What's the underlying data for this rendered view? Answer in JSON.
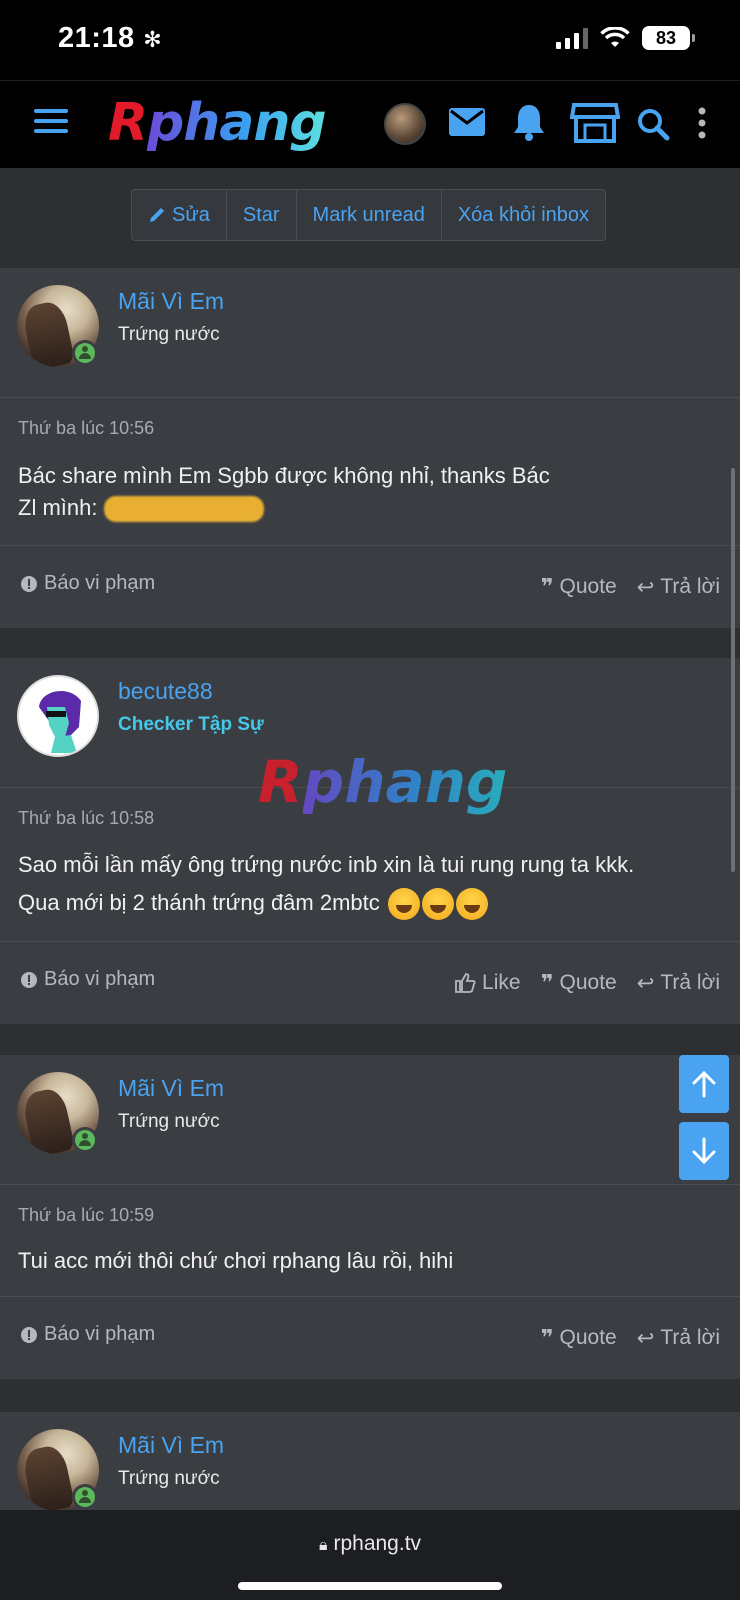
{
  "status": {
    "time": "21:18",
    "battery": "83"
  },
  "header": {
    "logo_r": "R",
    "logo_rest": "phang"
  },
  "actions": {
    "edit": "Sửa",
    "star": "Star",
    "mark_unread": "Mark unread",
    "remove": "Xóa khỏi inbox"
  },
  "posts": [
    {
      "username": "Mãi Vì Em",
      "title": "Trứng nước",
      "date": "Thứ ba lúc 10:56",
      "line1": "Bác share mình Em Sgbb được không nhỉ, thanks Bác",
      "line2": "Zl mình:",
      "report": "Báo vi phạm",
      "quote": "Quote",
      "reply": "Trả lời"
    },
    {
      "username": "becute88",
      "title": "Checker Tập Sự",
      "date": "Thứ ba lúc 10:58",
      "line1": "Sao mỗi lần mấy ông trứng nước inb xin là tui rung rung ta kkk.",
      "line2": "Qua mới bị 2 thánh trứng đâm 2mbtc",
      "report": "Báo vi phạm",
      "like": "Like",
      "quote": "Quote",
      "reply": "Trả lời"
    },
    {
      "username": "Mãi Vì Em",
      "title": "Trứng nước",
      "date": "Thứ ba lúc 10:59",
      "line1": "Tui acc mới thôi chứ chơi rphang lâu rồi, hihi",
      "report": "Báo vi phạm",
      "quote": "Quote",
      "reply": "Trả lời"
    },
    {
      "username": "Mãi Vì Em",
      "title": "Trứng nước"
    }
  ],
  "watermark": {
    "r": "R",
    "rest": "phang"
  },
  "browser": {
    "url": "rphang.tv"
  },
  "colors": {
    "accent": "#4aa3f0",
    "online": "#5cb85c",
    "rank": "#45c8e8"
  }
}
